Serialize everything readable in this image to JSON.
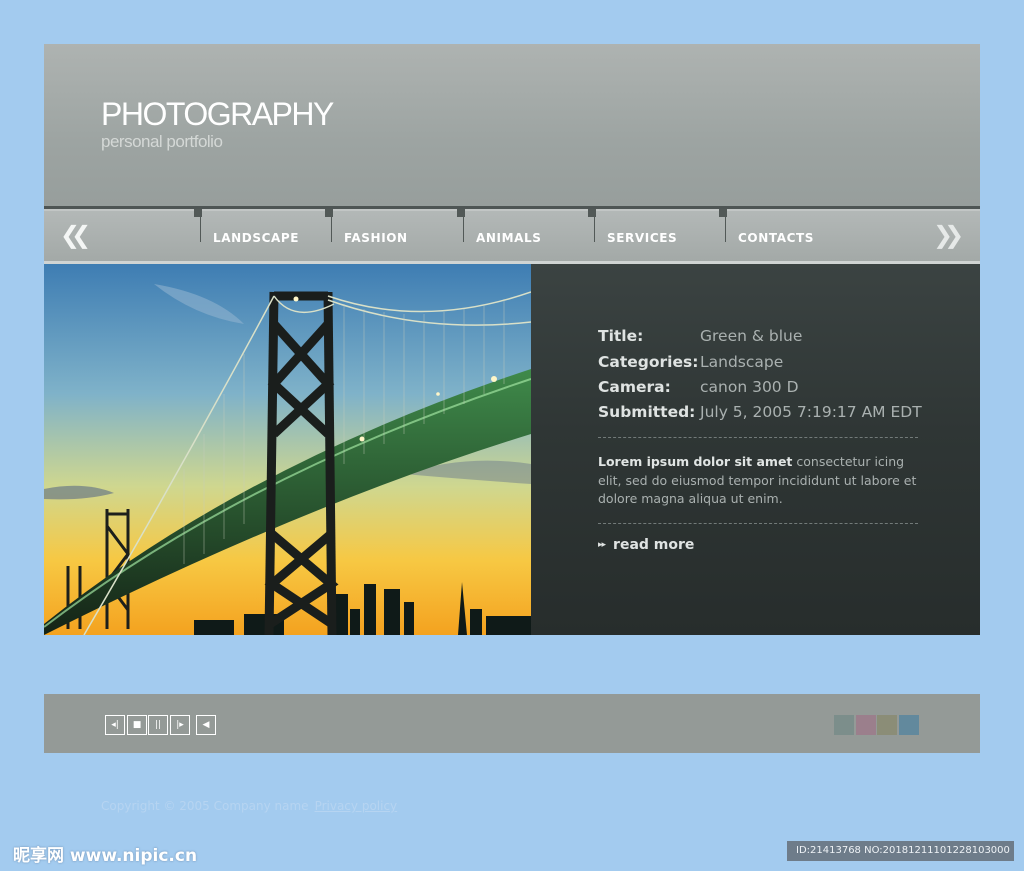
{
  "header": {
    "title": "PHOTOGRAPHY",
    "subtitle": "personal portfolio"
  },
  "nav": {
    "prev_icon": "double-chevron-left-icon",
    "next_icon": "double-chevron-right-icon",
    "items": [
      {
        "label": "LANDSCAPE"
      },
      {
        "label": "FASHION"
      },
      {
        "label": "ANIMALS"
      },
      {
        "label": "SERVICES"
      },
      {
        "label": "CONTACTS"
      }
    ]
  },
  "photo": {
    "subject": "suspension bridge at sunset"
  },
  "details": {
    "rows": [
      {
        "label": "Title:",
        "value": "Green & blue"
      },
      {
        "label": "Categories:",
        "value": "Landscape"
      },
      {
        "label": "Camera:",
        "value": "canon 300 D"
      },
      {
        "label": "Submitted:",
        "value": "July 5, 2005 7:19:17 AM EDT"
      }
    ],
    "description_lead": "Lorem ipsum dolor sit amet",
    "description_body": " consectetur icing elit, sed do eiusmod tempor incididunt ut labore et dolore magna aliqua ut enim.",
    "read_more": "read more"
  },
  "player": {
    "controls": [
      {
        "name": "previous-icon",
        "glyph": "◂|"
      },
      {
        "name": "stop-icon",
        "glyph": "■"
      },
      {
        "name": "pause-icon",
        "glyph": "||"
      },
      {
        "name": "next-icon",
        "glyph": "|▸"
      },
      {
        "name": "volume-icon",
        "glyph": "◀"
      }
    ],
    "swatches": [
      "#7c8e8b",
      "#9b7f8c",
      "#8b8d77",
      "#62899d"
    ]
  },
  "footer": {
    "copyright": "Copyright © 2005 Company name",
    "privacy": "Privacy policy"
  },
  "watermark": {
    "left": "昵享网 www.nipic.cn",
    "right": "ID:21413768 NO:20181211101228103000"
  }
}
